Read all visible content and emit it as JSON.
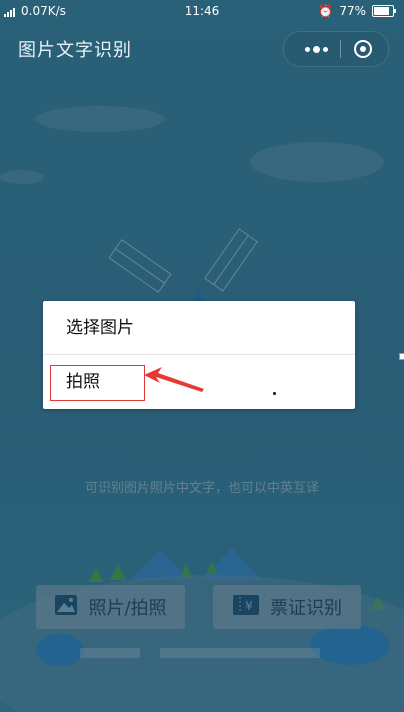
{
  "status_bar": {
    "network": "4G 4G",
    "speed": "0.07K/s",
    "time": "11:46",
    "battery": "77%",
    "battery_level": 0.77
  },
  "nav": {
    "title": "图片文字识别"
  },
  "hint_text": "可识别图片照片中文字，也可以中英互译",
  "buttons": {
    "photo_label": "照片/拍照",
    "ticket_label": "票证识别"
  },
  "dialog": {
    "option_select": "选择图片",
    "option_camera": "拍照"
  },
  "colors": {
    "annotation_red": "#e53935",
    "button_text": "#1f4e66"
  }
}
